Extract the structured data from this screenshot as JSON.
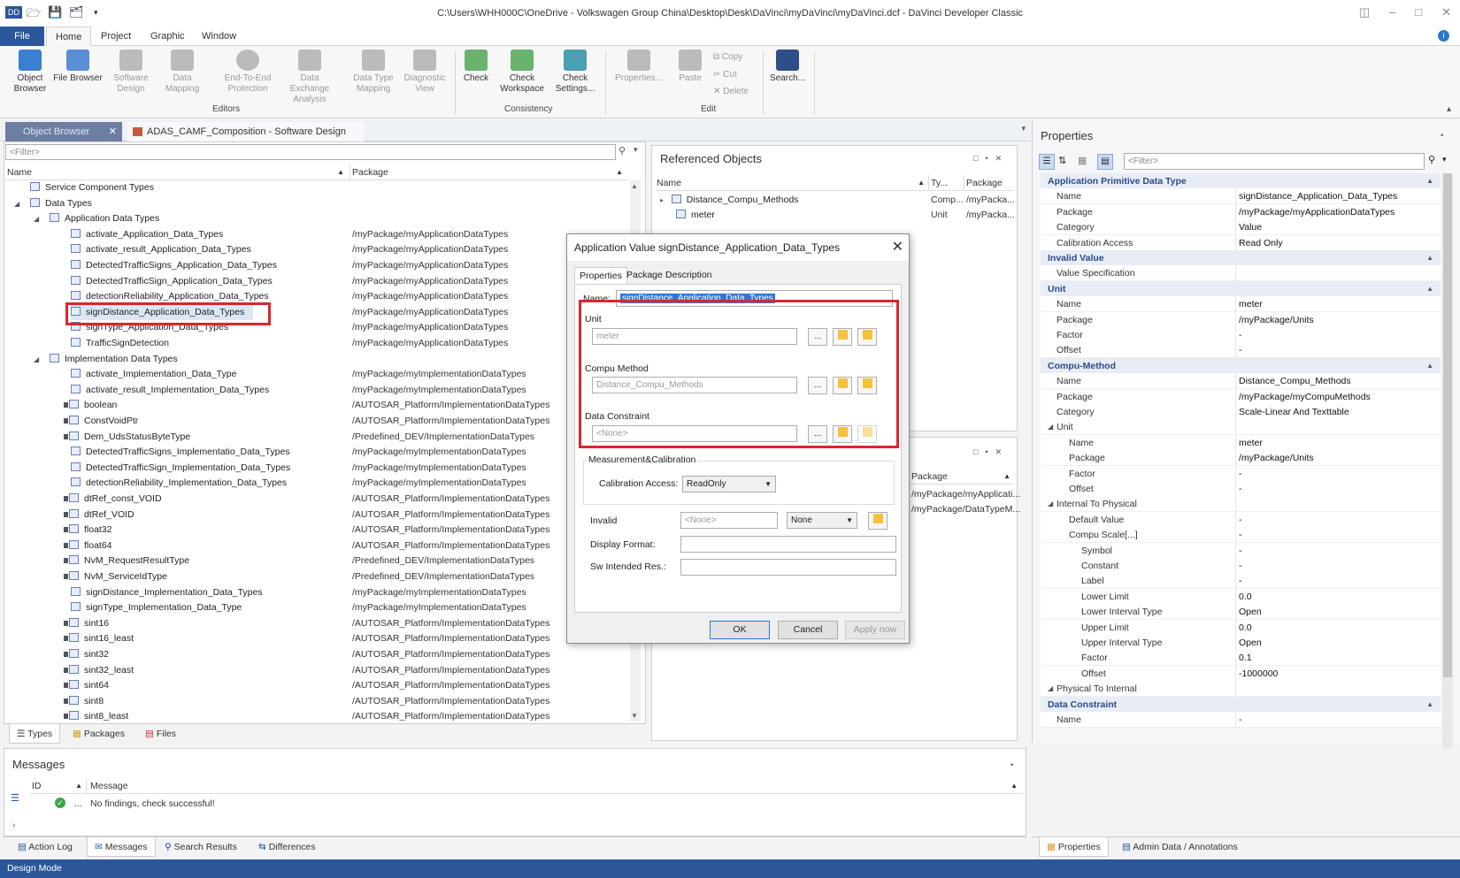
{
  "window": {
    "title": "C:\\Users\\WHH000C\\OneDrive - Volkswagen Group China\\Desktop\\Desk\\DaVinci\\myDaVinci\\myDaVinci.dcf - DaVinci Developer Classic"
  },
  "menu": {
    "file": "File",
    "home": "Home",
    "project": "Project",
    "graphic": "Graphic",
    "window": "Window"
  },
  "ribbon": {
    "object_browser": "Object Browser",
    "file_browser": "File Browser",
    "software_design": "Software Design",
    "data_mapping": "Data Mapping",
    "end_to_end": "End-To-End Protection",
    "data_exchange": "Data Exchange Analysis",
    "data_type_mapping": "Data Type Mapping",
    "diagnostic_view": "Diagnostic View",
    "editors_group": "Editors",
    "check": "Check",
    "check_workspace": "Check Workspace",
    "check_settings": "Check Settings...",
    "consistency_group": "Consistency",
    "properties": "Properties...",
    "paste": "Paste",
    "copy": "Copy",
    "cut": "Cut",
    "delete": "Delete",
    "edit_group": "Edit",
    "search": "Search..."
  },
  "doc_tabs": {
    "object_browser": "Object Browser",
    "software_design": "ADAS_CAMF_Composition - Software Design"
  },
  "object_browser": {
    "filter_placeholder": "<Filter>",
    "col_name": "Name",
    "col_package": "Package",
    "rows": [
      {
        "name": "Service Component Types",
        "pkg": ""
      },
      {
        "name": "Data Types",
        "pkg": ""
      },
      {
        "name": "Application Data Types",
        "pkg": ""
      },
      {
        "name": "activate_Application_Data_Types",
        "pkg": "/myPackage/myApplicationDataTypes"
      },
      {
        "name": "activate_result_Application_Data_Types",
        "pkg": "/myPackage/myApplicationDataTypes"
      },
      {
        "name": "DetectedTrafficSigns_Application_Data_Types",
        "pkg": "/myPackage/myApplicationDataTypes"
      },
      {
        "name": "DetectedTrafficSign_Application_Data_Types",
        "pkg": "/myPackage/myApplicationDataTypes"
      },
      {
        "name": "detectionReliability_Application_Data_Types",
        "pkg": "/myPackage/myApplicationDataTypes"
      },
      {
        "name": "signDistance_Application_Data_Types",
        "pkg": "/myPackage/myApplicationDataTypes"
      },
      {
        "name": "signType_Application_Data_Types",
        "pkg": "/myPackage/myApplicationDataTypes"
      },
      {
        "name": "TrafficSignDetection",
        "pkg": "/myPackage/myApplicationDataTypes"
      },
      {
        "name": "Implementation Data Types",
        "pkg": ""
      },
      {
        "name": "activate_Implementation_Data_Type",
        "pkg": "/myPackage/myImplementationDataTypes"
      },
      {
        "name": "activate_result_Implementation_Data_Types",
        "pkg": "/myPackage/myImplementationDataTypes"
      },
      {
        "name": "boolean",
        "pkg": "/AUTOSAR_Platform/ImplementationDataTypes"
      },
      {
        "name": "ConstVoidPtr",
        "pkg": "/AUTOSAR_Platform/ImplementationDataTypes"
      },
      {
        "name": "Dem_UdsStatusByteType",
        "pkg": "/Predefined_DEV/ImplementationDataTypes"
      },
      {
        "name": "DetectedTrafficSigns_Implementatio_Data_Types",
        "pkg": "/myPackage/myImplementationDataTypes"
      },
      {
        "name": "DetectedTrafficSign_Implementation_Data_Types",
        "pkg": "/myPackage/myImplementationDataTypes"
      },
      {
        "name": "detectionReliability_Implementation_Data_Types",
        "pkg": "/myPackage/myImplementationDataTypes"
      },
      {
        "name": "dtRef_const_VOID",
        "pkg": "/AUTOSAR_Platform/ImplementationDataTypes"
      },
      {
        "name": "dtRef_VOID",
        "pkg": "/AUTOSAR_Platform/ImplementationDataTypes"
      },
      {
        "name": "float32",
        "pkg": "/AUTOSAR_Platform/ImplementationDataTypes"
      },
      {
        "name": "float64",
        "pkg": "/AUTOSAR_Platform/ImplementationDataTypes"
      },
      {
        "name": "NvM_RequestResultType",
        "pkg": "/Predefined_DEV/ImplementationDataTypes"
      },
      {
        "name": "NvM_ServiceIdType",
        "pkg": "/Predefined_DEV/ImplementationDataTypes"
      },
      {
        "name": "signDistance_Implementation_Data_Types",
        "pkg": "/myPackage/myImplementationDataTypes"
      },
      {
        "name": "signType_Implementation_Data_Type",
        "pkg": "/myPackage/myImplementationDataTypes"
      },
      {
        "name": "sint16",
        "pkg": "/AUTOSAR_Platform/ImplementationDataTypes"
      },
      {
        "name": "sint16_least",
        "pkg": "/AUTOSAR_Platform/ImplementationDataTypes"
      },
      {
        "name": "sint32",
        "pkg": "/AUTOSAR_Platform/ImplementationDataTypes"
      },
      {
        "name": "sint32_least",
        "pkg": "/AUTOSAR_Platform/ImplementationDataTypes"
      },
      {
        "name": "sint64",
        "pkg": "/AUTOSAR_Platform/ImplementationDataTypes"
      },
      {
        "name": "sint8",
        "pkg": "/AUTOSAR_Platform/ImplementationDataTypes"
      },
      {
        "name": "sint8_least",
        "pkg": "/AUTOSAR_Platform/ImplementationDataTypes"
      }
    ],
    "bottom_tabs": [
      "Types",
      "Packages",
      "Files"
    ]
  },
  "referenced": {
    "title": "Referenced Objects",
    "col_name": "Name",
    "col_type": "Ty...",
    "col_package": "Package",
    "rows": [
      {
        "name": "Distance_Compu_Methods",
        "type": "Comp...",
        "pkg": "/myPacka..."
      },
      {
        "name": "meter",
        "type": "Unit",
        "pkg": "/myPacka..."
      }
    ],
    "lower_col_package": "Package",
    "lower_rows": [
      "/myPackage/myApplicati...",
      "/myPackage/DataTypeM..."
    ]
  },
  "dialog": {
    "title": "Application Value signDistance_Application_Data_Types",
    "tabs": [
      "Properties",
      "Package",
      "Description"
    ],
    "name_label": "Name:",
    "name_value": "signDistance_Application_Data_Types",
    "unit_label": "Unit",
    "unit_value": "meter",
    "compu_label": "Compu Method",
    "compu_value": "Distance_Compu_Methods",
    "constraint_label": "Data Constraint",
    "constraint_value": "<None>",
    "browse": "...",
    "meas_label": "Measurement&Calibration",
    "calib_label": "Calibration Access:",
    "calib_value": "ReadOnly",
    "invalid_label": "Invalid",
    "invalid_value": "<None>",
    "invalid_select": "None",
    "display_format_label": "Display Format:",
    "sw_intended_label": "Sw Intended Res.:",
    "ok": "OK",
    "cancel": "Cancel",
    "apply": "Apply now"
  },
  "properties": {
    "title": "Properties",
    "filter_placeholder": "<Filter>",
    "sections": [
      {
        "title": "Application Primitive Data Type",
        "rows": [
          {
            "k": "Name",
            "v": "signDistance_Application_Data_Types"
          },
          {
            "k": "Package",
            "v": "/myPackage/myApplicationDataTypes"
          },
          {
            "k": "Category",
            "v": "Value"
          },
          {
            "k": "Calibration Access",
            "v": "Read Only"
          }
        ]
      },
      {
        "title": "Invalid Value",
        "rows": [
          {
            "k": "Value Specification",
            "v": ""
          }
        ]
      },
      {
        "title": "Unit",
        "rows": [
          {
            "k": "Name",
            "v": "meter"
          },
          {
            "k": "Package",
            "v": "/myPackage/Units"
          },
          {
            "k": "Factor",
            "v": "-"
          },
          {
            "k": "Offset",
            "v": "-"
          }
        ]
      },
      {
        "title": "Compu-Method",
        "rows": [
          {
            "k": "Name",
            "v": "Distance_Compu_Methods"
          },
          {
            "k": "Package",
            "v": "/myPackage/myCompuMethods"
          },
          {
            "k": "Category",
            "v": "Scale-Linear And Texttable"
          },
          {
            "k": "Unit",
            "v": ""
          },
          {
            "k": "Name",
            "v": "meter"
          },
          {
            "k": "Package",
            "v": "/myPackage/Units"
          },
          {
            "k": "Factor",
            "v": "-"
          },
          {
            "k": "Offset",
            "v": "-"
          },
          {
            "k": "Internal To Physical",
            "v": ""
          },
          {
            "k": "Default Value",
            "v": "-"
          },
          {
            "k": "Compu Scale[...]",
            "v": "-"
          },
          {
            "k": "Symbol",
            "v": "-"
          },
          {
            "k": "Constant",
            "v": "-"
          },
          {
            "k": "Label",
            "v": "-"
          },
          {
            "k": "Lower Limit",
            "v": "0.0"
          },
          {
            "k": "Lower Interval Type",
            "v": "Open"
          },
          {
            "k": "Upper Limit",
            "v": "0.0"
          },
          {
            "k": "Upper Interval Type",
            "v": "Open"
          },
          {
            "k": "Factor",
            "v": "0.1"
          },
          {
            "k": "Offset",
            "v": "-1000000"
          },
          {
            "k": "Physical To Internal",
            "v": ""
          }
        ]
      },
      {
        "title": "Data Constraint",
        "rows": [
          {
            "k": "Name",
            "v": "-"
          }
        ]
      }
    ],
    "bottom_tabs": [
      "Properties",
      "Admin Data / Annotations"
    ]
  },
  "messages": {
    "title": "Messages",
    "col_id": "ID",
    "col_message": "Message",
    "row_dots": "...",
    "row_text": "No findings, check successful!",
    "tabs": [
      "Action Log",
      "Messages",
      "Search Results",
      "Differences"
    ]
  },
  "status": "Design Mode"
}
